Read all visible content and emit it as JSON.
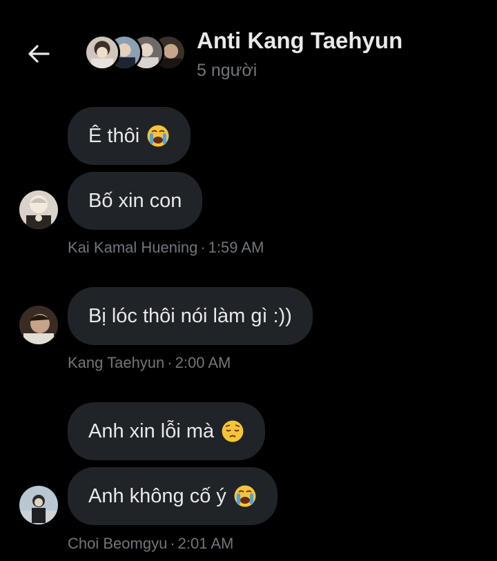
{
  "header": {
    "title": "Anti Kang Taehyun",
    "subtitle": "5 người",
    "back_icon": "arrow-left-icon"
  },
  "messages": [
    {
      "text": "Ê thôi",
      "emoji": "loudly-crying-face-emoji"
    },
    {
      "text": "Bố xin con"
    },
    {
      "text": "Bị lóc thôi nói làm gì :))"
    },
    {
      "text": "Anh xin lỗi mà",
      "emoji": "pensive-face-emoji"
    },
    {
      "text": "Anh không cố ý",
      "emoji": "loudly-crying-face-emoji"
    }
  ],
  "groups": [
    {
      "sender": "Kai Kamal Huening",
      "time": "1:59 AM"
    },
    {
      "sender": "Kang Taehyun",
      "time": "2:00 AM"
    },
    {
      "sender": "Choi Beomgyu",
      "time": "2:01 AM"
    }
  ],
  "separator": "·",
  "colors": {
    "background": "#000000",
    "bubble": "#202327",
    "text": "#e7e9ea",
    "muted": "#71767b"
  }
}
